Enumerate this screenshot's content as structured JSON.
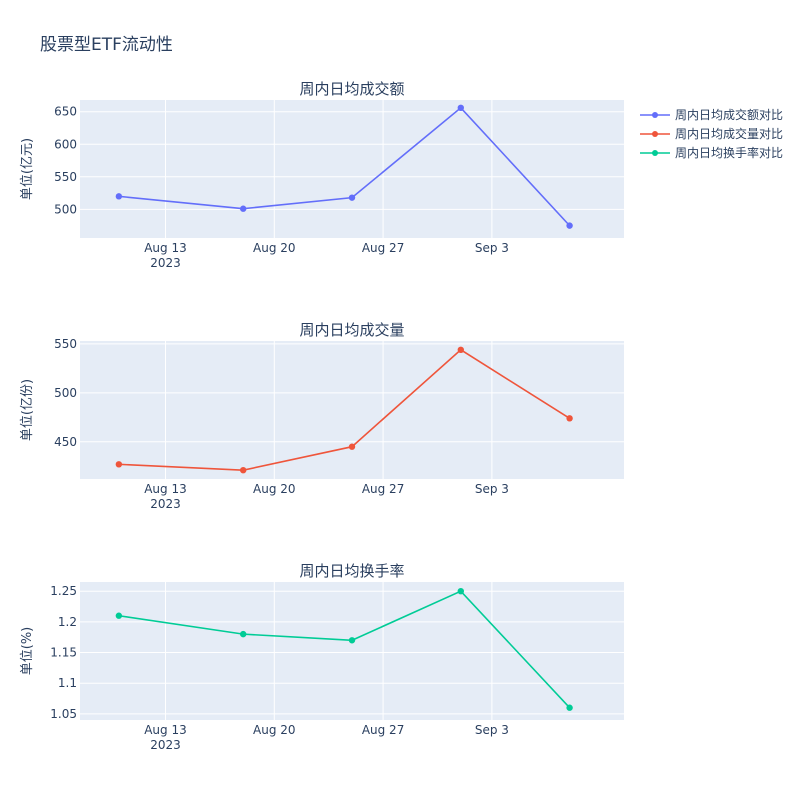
{
  "title": "股票型ETF流动性",
  "chart_data": [
    {
      "type": "line",
      "title": "周内日均成交额",
      "xlabel": "",
      "ylabel": "单位(亿元)",
      "x": [
        "2023-08-10",
        "2023-08-18",
        "2023-08-25",
        "2023-09-01",
        "2023-09-08"
      ],
      "series": [
        {
          "name": "周内日均成交额对比",
          "values": [
            520,
            501,
            518,
            656,
            475
          ],
          "color": "#636efa"
        }
      ],
      "ylim": [
        456,
        668
      ],
      "yticks": [
        500,
        550,
        600,
        650
      ],
      "xticks": [
        "2023-08-13",
        "2023-08-20",
        "2023-08-27",
        "2023-09-03"
      ],
      "xtick_labels": [
        "Aug 13",
        "Aug 20",
        "Aug 27",
        "Sep 3"
      ],
      "xtick_year": "2023",
      "grid": true
    },
    {
      "type": "line",
      "title": "周内日均成交量",
      "xlabel": "",
      "ylabel": "单位(亿份)",
      "x": [
        "2023-08-10",
        "2023-08-18",
        "2023-08-25",
        "2023-09-01",
        "2023-09-08"
      ],
      "series": [
        {
          "name": "周内日均成交量对比",
          "values": [
            427,
            421,
            445,
            544,
            474
          ],
          "color": "#ef553b"
        }
      ],
      "ylim": [
        412,
        553
      ],
      "yticks": [
        450,
        500,
        550
      ],
      "xticks": [
        "2023-08-13",
        "2023-08-20",
        "2023-08-27",
        "2023-09-03"
      ],
      "xtick_labels": [
        "Aug 13",
        "Aug 20",
        "Aug 27",
        "Sep 3"
      ],
      "xtick_year": "2023",
      "grid": true
    },
    {
      "type": "line",
      "title": "周内日均换手率",
      "xlabel": "",
      "ylabel": "单位(%)",
      "x": [
        "2023-08-10",
        "2023-08-18",
        "2023-08-25",
        "2023-09-01",
        "2023-09-08"
      ],
      "series": [
        {
          "name": "周内日均换手率对比",
          "values": [
            1.21,
            1.18,
            1.17,
            1.25,
            1.06
          ],
          "color": "#00cc96"
        }
      ],
      "ylim": [
        1.04,
        1.265
      ],
      "yticks": [
        1.05,
        1.1,
        1.15,
        1.2,
        1.25
      ],
      "ytick_labels": [
        "1.05",
        "1.1",
        "1.15",
        "1.2",
        "1.25"
      ],
      "xticks": [
        "2023-08-13",
        "2023-08-20",
        "2023-08-27",
        "2023-09-03"
      ],
      "xtick_labels": [
        "Aug 13",
        "Aug 20",
        "Aug 27",
        "Sep 3"
      ],
      "xtick_year": "2023",
      "grid": true
    }
  ],
  "legend": {
    "position": "top-right",
    "items": [
      {
        "label": "周内日均成交额对比",
        "color": "#636efa"
      },
      {
        "label": "周内日均成交量对比",
        "color": "#ef553b"
      },
      {
        "label": "周内日均换手率对比",
        "color": "#00cc96"
      }
    ]
  },
  "colors": {
    "plot_bg": "#e5ecf6",
    "grid": "#ffffff",
    "text": "#2a3f5f"
  }
}
